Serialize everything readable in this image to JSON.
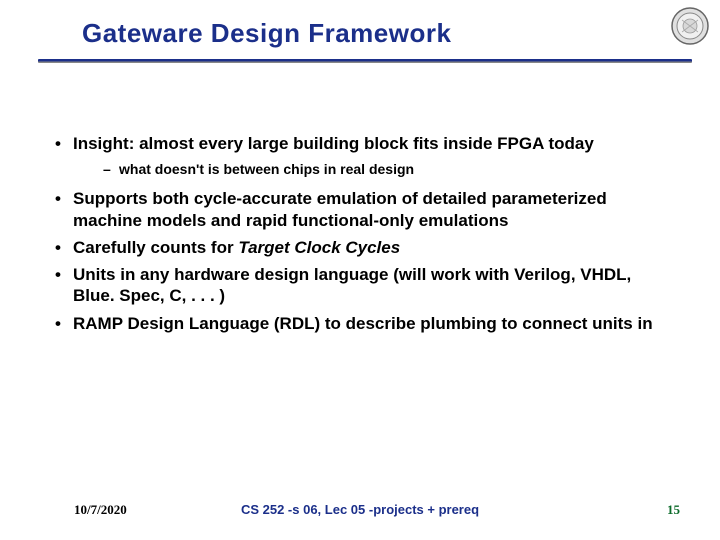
{
  "title": "Gateware Design Framework",
  "logo_name": "seal-emblem",
  "bullets": [
    {
      "text": "Insight: almost every large building block fits inside FPGA today",
      "sub": [
        {
          "text": "what doesn't is between chips in real design"
        }
      ]
    },
    {
      "text": "Supports both cycle-accurate emulation of detailed parameterized machine models and rapid functional-only emulations"
    },
    {
      "text_pre": "Carefully counts for ",
      "text_ital": "Target Clock Cycles"
    },
    {
      "text": "Units in any hardware design language (will work with Verilog, VHDL, Blue. Spec, C, . . . )"
    },
    {
      "text": "RAMP Design Language (RDL) to describe plumbing to connect units in"
    }
  ],
  "footer": {
    "date": "10/7/2020",
    "center": "CS 252 -s 06, Lec 05 -projects + prereq",
    "page": "15"
  }
}
